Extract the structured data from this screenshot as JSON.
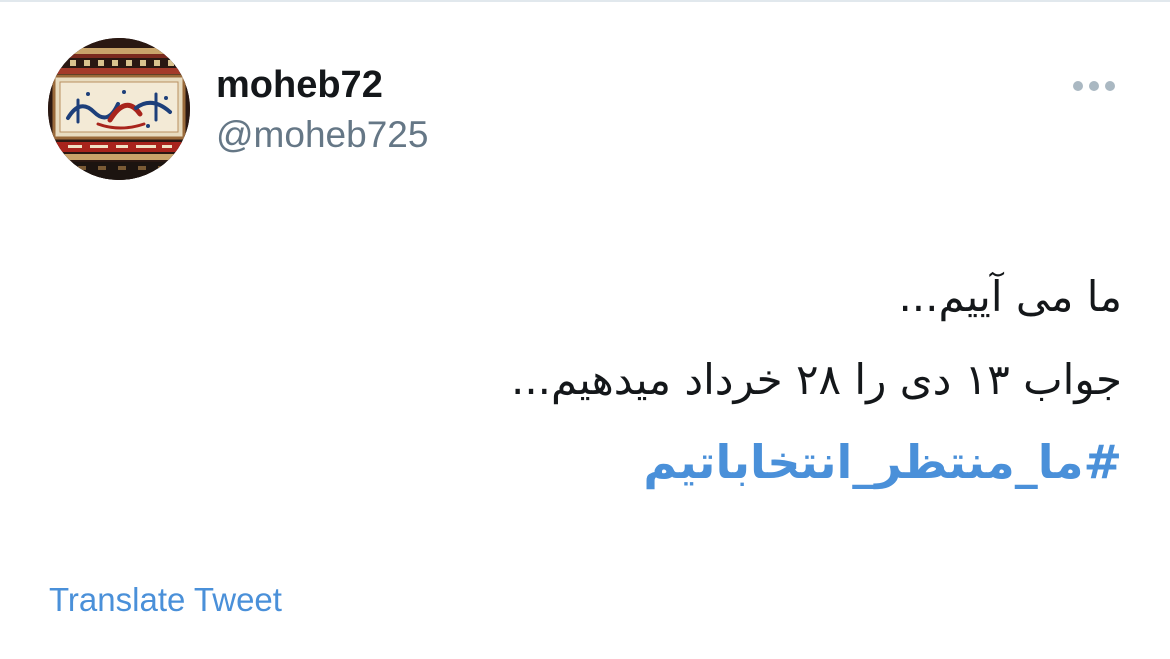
{
  "user": {
    "display_name": "moheb72",
    "handle": "@moheb725",
    "avatar_icon": "calligraphy-carpet-avatar"
  },
  "menu": {
    "icon": "more-dots-icon"
  },
  "tweet": {
    "line_1": "ما می آییم...",
    "line_2": "جواب ۱۳ دی را ۲۸ خرداد میدهیم...",
    "hashtag": "#ما_منتظر_انتخاباتیم"
  },
  "footer": {
    "translate_label": "Translate Tweet"
  },
  "colors": {
    "link": "#4a90d9",
    "secondary_text": "#657786",
    "primary_text": "#14171a"
  }
}
